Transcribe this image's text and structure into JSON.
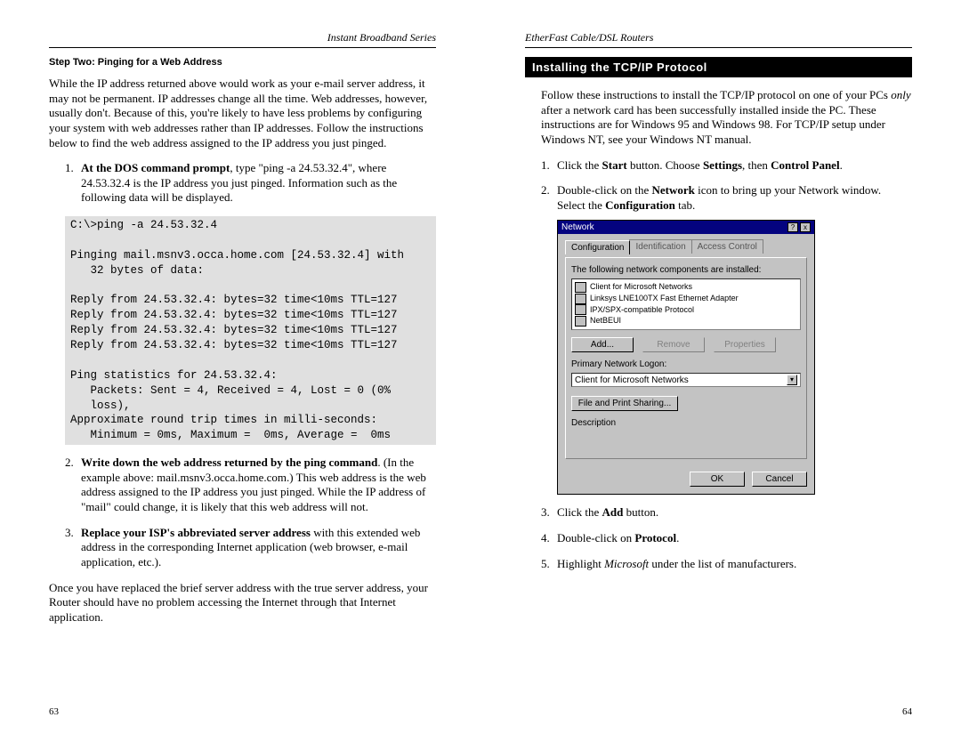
{
  "left": {
    "running_head": "Instant Broadband Series",
    "subhead": "Step Two: Pinging for a Web Address",
    "intro": "While the IP address returned above would work as your e-mail server address, it may not be permanent. IP addresses change all the time. Web addresses, however, usually don't. Because of this, you're likely to have less problems by configuring your system with web addresses rather than IP addresses. Follow the instructions below to find the web address assigned to the IP address you just pinged.",
    "step1_num": "1.",
    "step1_lead": "At the DOS command prompt",
    "step1_rest": ", type \"ping -a 24.53.32.4\", where 24.53.32.4 is the IP address you just pinged. Information such as the following data will be displayed.",
    "code": "C:\\>ping -a 24.53.32.4\n\nPinging mail.msnv3.occa.home.com [24.53.32.4] with\n   32 bytes of data:\n\nReply from 24.53.32.4: bytes=32 time<10ms TTL=127\nReply from 24.53.32.4: bytes=32 time<10ms TTL=127\nReply from 24.53.32.4: bytes=32 time<10ms TTL=127\nReply from 24.53.32.4: bytes=32 time<10ms TTL=127\n\nPing statistics for 24.53.32.4:\n   Packets: Sent = 4, Received = 4, Lost = 0 (0%\n   loss),\nApproximate round trip times in milli-seconds:\n   Minimum = 0ms, Maximum =  0ms, Average =  0ms",
    "step2_num": "2.",
    "step2_lead": "Write down the web address returned by the ping command",
    "step2_rest": ". (In the example above: mail.msnv3.occa.home.com.) This web address is the web address assigned to the IP address you just pinged. While the IP address of \"mail\" could change, it is likely that this web address will not.",
    "step3_num": "3.",
    "step3_lead": "Replace your ISP's abbreviated server address",
    "step3_rest": " with this extended web address in the corresponding Internet application (web browser, e-mail application, etc.).",
    "outro": "Once you have replaced the brief server address with the true server address, your Router should have no problem accessing the Internet through that Internet application.",
    "page_num": "63"
  },
  "right": {
    "running_head": "EtherFast Cable/DSL Routers",
    "section_title": "Installing the TCP/IP Protocol",
    "intro_a": "Follow these instructions to install the TCP/IP protocol on one of your PCs ",
    "intro_italic": "only",
    "intro_b": " after a network card has been successfully installed inside the PC. These instructions are for Windows 95 and Windows 98. For TCP/IP setup under Windows NT, see your Windows NT manual.",
    "step1_num": "1.",
    "step1_a": "Click the ",
    "step1_b1": "Start",
    "step1_c": " button. Choose ",
    "step1_b2": "Settings",
    "step1_d": ", then ",
    "step1_b3": "Control Panel",
    "step1_e": ".",
    "step2_num": "2.",
    "step2_a": "Double-click on the ",
    "step2_b1": "Network",
    "step2_c": " icon to bring up your Network window. Select the ",
    "step2_b2": "Configuration",
    "step2_d": " tab.",
    "step3_num": "3.",
    "step3_a": "Click the ",
    "step3_b": "Add",
    "step3_c": " button.",
    "step4_num": "4.",
    "step4_a": "Double-click on ",
    "step4_b": "Protocol",
    "step4_c": ".",
    "step5_num": "5.",
    "step5_a": "Highlight ",
    "step5_i": "Microsoft",
    "step5_b": " under the list of manufacturers.",
    "page_num": "64",
    "win95": {
      "title": "Network",
      "tabs": [
        "Configuration",
        "Identification",
        "Access Control"
      ],
      "list_label": "The following network components are installed:",
      "list": [
        "Client for Microsoft Networks",
        "Linksys LNE100TX Fast Ethernet Adapter",
        "IPX/SPX-compatible Protocol",
        "NetBEUI"
      ],
      "btn_add": "Add...",
      "btn_remove": "Remove",
      "btn_prop": "Properties",
      "logon_label": "Primary Network Logon:",
      "logon_value": "Client for Microsoft Networks",
      "file_btn": "File and Print Sharing...",
      "desc_label": "Description",
      "ok": "OK",
      "cancel": "Cancel"
    }
  }
}
